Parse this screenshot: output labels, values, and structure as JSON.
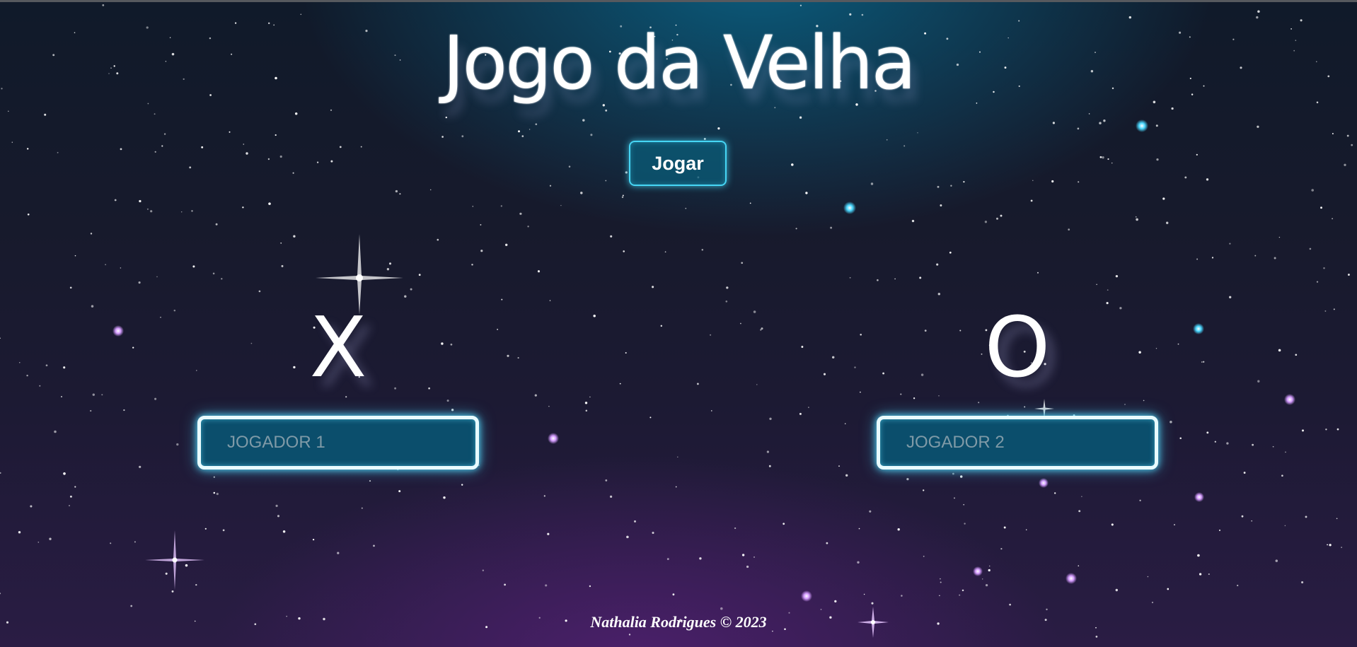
{
  "page": {
    "title": "Jogo da Velha",
    "play_button_label": "Jogar",
    "footer": "Nathalia Rodrigues © 2023"
  },
  "players": [
    {
      "mark": "X",
      "placeholder": "JOGADOR 1",
      "value": ""
    },
    {
      "mark": "O",
      "placeholder": "JOGADOR 2",
      "value": ""
    }
  ],
  "colors": {
    "background_top": "#101a2a",
    "background_glow_teal": "#0a688c",
    "background_glow_purple": "#4e206e",
    "accent_cyan": "#46d6f5",
    "input_fill": "#0b4e6c",
    "text": "#ffffff",
    "placeholder": "#7f9aa7"
  },
  "icons": {
    "decorations": [
      "sparkle-star-icon",
      "starfield"
    ]
  }
}
